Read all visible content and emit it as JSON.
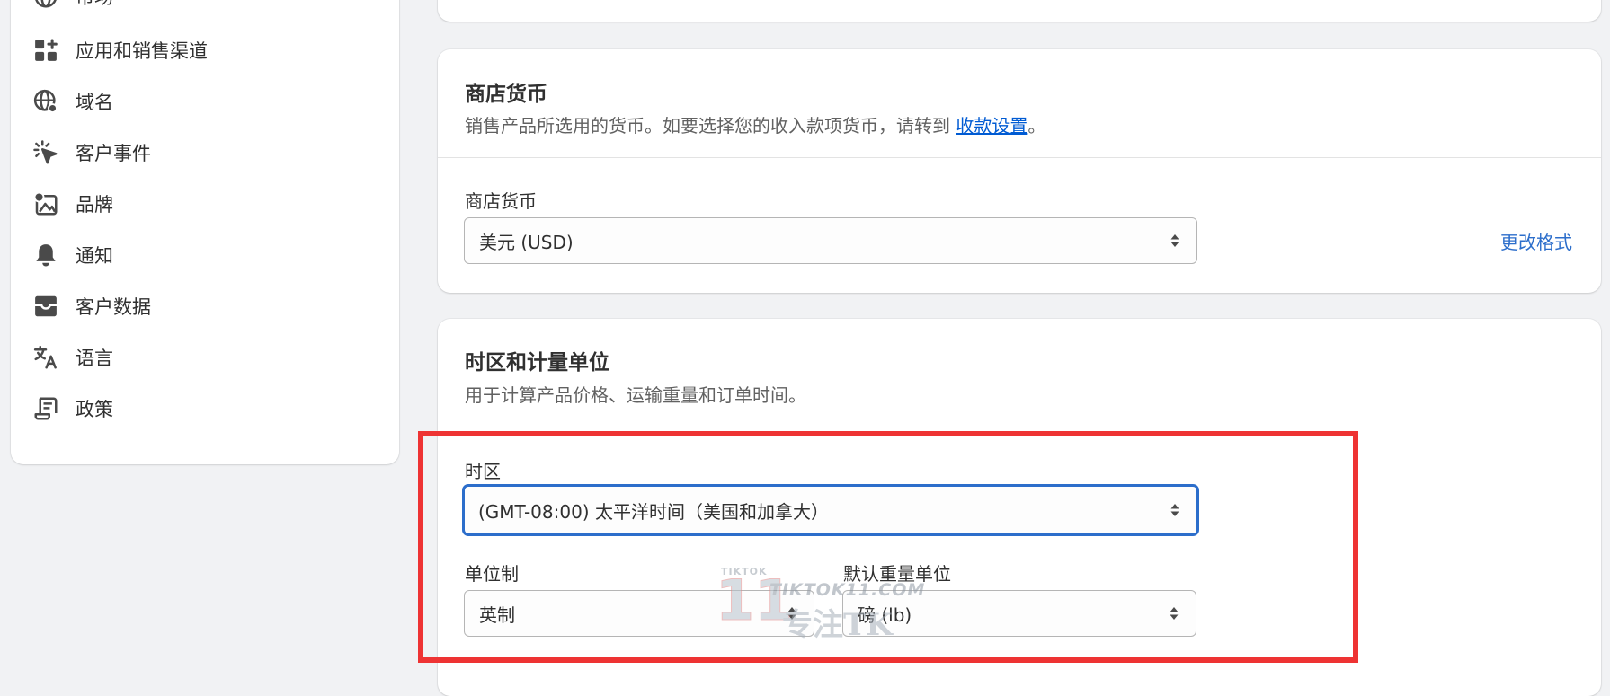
{
  "sidebar": {
    "items": [
      {
        "label": "市场",
        "icon": "globe-icon"
      },
      {
        "label": "应用和销售渠道",
        "icon": "apps-icon"
      },
      {
        "label": "域名",
        "icon": "domain-globe-icon"
      },
      {
        "label": "客户事件",
        "icon": "cursor-click-icon"
      },
      {
        "label": "品牌",
        "icon": "brand-image-icon"
      },
      {
        "label": "通知",
        "icon": "bell-icon"
      },
      {
        "label": "客户数据",
        "icon": "inbox-icon"
      },
      {
        "label": "语言",
        "icon": "translate-icon"
      },
      {
        "label": "政策",
        "icon": "policy-scroll-icon"
      }
    ]
  },
  "currency_card": {
    "title": "商店货币",
    "description_prefix": "销售产品所选用的货币。如要选择您的收入款项货币，请转到 ",
    "description_link": "收款设置",
    "description_suffix": "。",
    "field_label": "商店货币",
    "selected_value": "美元 (USD)",
    "change_format_link": "更改格式"
  },
  "timezone_card": {
    "title": "时区和计量单位",
    "description": "用于计算产品价格、运输重量和订单时间。",
    "timezone_label": "时区",
    "timezone_value": "(GMT-08:00) 太平洋时间（美国和加拿大）",
    "unit_system_label": "单位制",
    "unit_system_value": "英制",
    "weight_unit_label": "默认重量单位",
    "weight_unit_value": "磅 (lb)"
  },
  "watermark": {
    "small_text": "TIKTOK",
    "number": "11",
    "domain": "TIKTOK11.COM",
    "slogan": "专注TK"
  },
  "colors": {
    "page_background": "#f1f2f4",
    "card_background": "#ffffff",
    "link": "#005bd3",
    "focus_ring": "#2c6ecb",
    "highlight_box": "#ee3333"
  }
}
